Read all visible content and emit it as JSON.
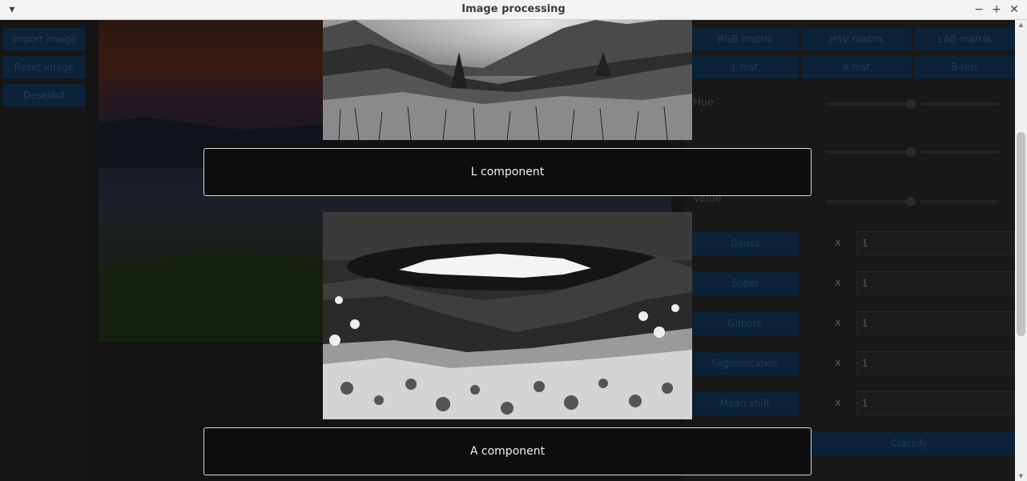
{
  "window": {
    "title": "Image processing",
    "menu_icon": "chevron-down-icon",
    "minimize": "−",
    "maximize": "+",
    "close": "✕"
  },
  "left_buttons": [
    "Import image",
    "Reset image",
    "Deselect"
  ],
  "matrix_buttons": [
    "RGB matrix",
    "HSV matrix",
    "LAB matrix"
  ],
  "hist_buttons": [
    "L hist",
    "A hist",
    "B hist"
  ],
  "sliders": [
    {
      "label": "Hue",
      "left_level": 0.85,
      "right_level": 0.0
    },
    {
      "label": "",
      "left_level": 0.85,
      "right_level": 0.0
    },
    {
      "label": "Value",
      "left_level": 0.85,
      "right_level": 0.0
    }
  ],
  "filters": [
    {
      "label": "Gauss",
      "x": "x",
      "value": "1"
    },
    {
      "label": "Sobel",
      "x": "x",
      "value": "1"
    },
    {
      "label": "Gabore",
      "x": "x",
      "value": "1"
    },
    {
      "label": "Segmentation",
      "x": "x",
      "value": "1"
    },
    {
      "label": "Mean shift",
      "x": "x",
      "value": "1"
    }
  ],
  "classify_label": "Classify",
  "dialog": {
    "components": [
      {
        "label": "L component"
      },
      {
        "label": "A component"
      }
    ]
  },
  "colors": {
    "accent_blue": "#0b2238",
    "dialog_label_bg": "#0d0d0d",
    "titlebar_bg": "#f3f3f3"
  }
}
